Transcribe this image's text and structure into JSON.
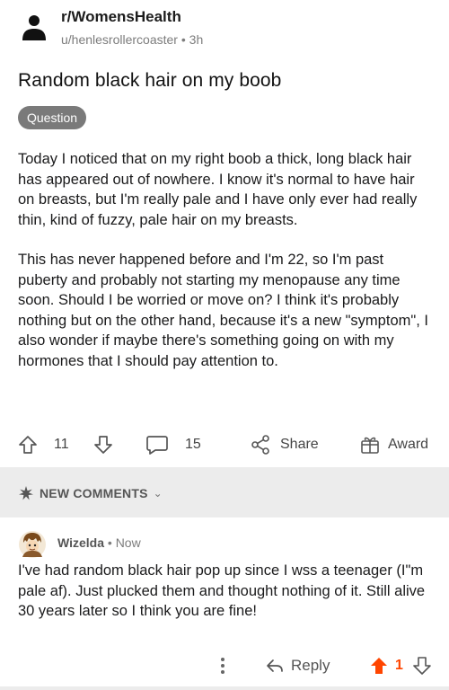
{
  "post": {
    "subreddit": "r/WomensHealth",
    "author": "u/henlesrollercoaster",
    "separator": "•",
    "age": "3h",
    "title": "Random black hair on my boob",
    "flair": "Question",
    "paragraphs": [
      "Today I noticed that on my right boob a thick, long black hair has appeared out of nowhere. I know it's normal to have hair on breasts, but I'm really pale and I have only ever had really thin, kind of fuzzy, pale hair on my breasts.",
      "This has never happened before and I'm 22, so I'm past puberty and probably not starting my menopause any time soon. Should I be worried or move on? I think it's probably nothing but on the other hand, because it's a new \"symptom\", I also wonder if maybe there's something going on with my hormones that I should pay attention to."
    ],
    "votes": "11",
    "comments_count": "15",
    "share_label": "Share",
    "award_label": "Award"
  },
  "comments_section": {
    "sort_label": "NEW COMMENTS",
    "chevron": "⌄"
  },
  "comment": {
    "author": "Wizelda",
    "separator": "•",
    "age": "Now",
    "text": "I've had random black hair pop up since I wss a teenager (I\"m pale af). Just plucked them and thought nothing of it. Still alive 30 years later so I think you are fine!",
    "reply_label": "Reply",
    "votes": "1",
    "upvote_color": "#ff4500"
  },
  "icons": {
    "subreddit_avatar": "user-silhouette-icon",
    "upvote": "arrow-up-outline-icon",
    "downvote": "arrow-down-outline-icon",
    "comment": "speech-bubble-icon",
    "share": "share-nodes-icon",
    "award": "gift-box-icon",
    "sort": "sparkle-icon",
    "more": "vertical-dots-icon",
    "reply": "reply-arrow-icon"
  }
}
